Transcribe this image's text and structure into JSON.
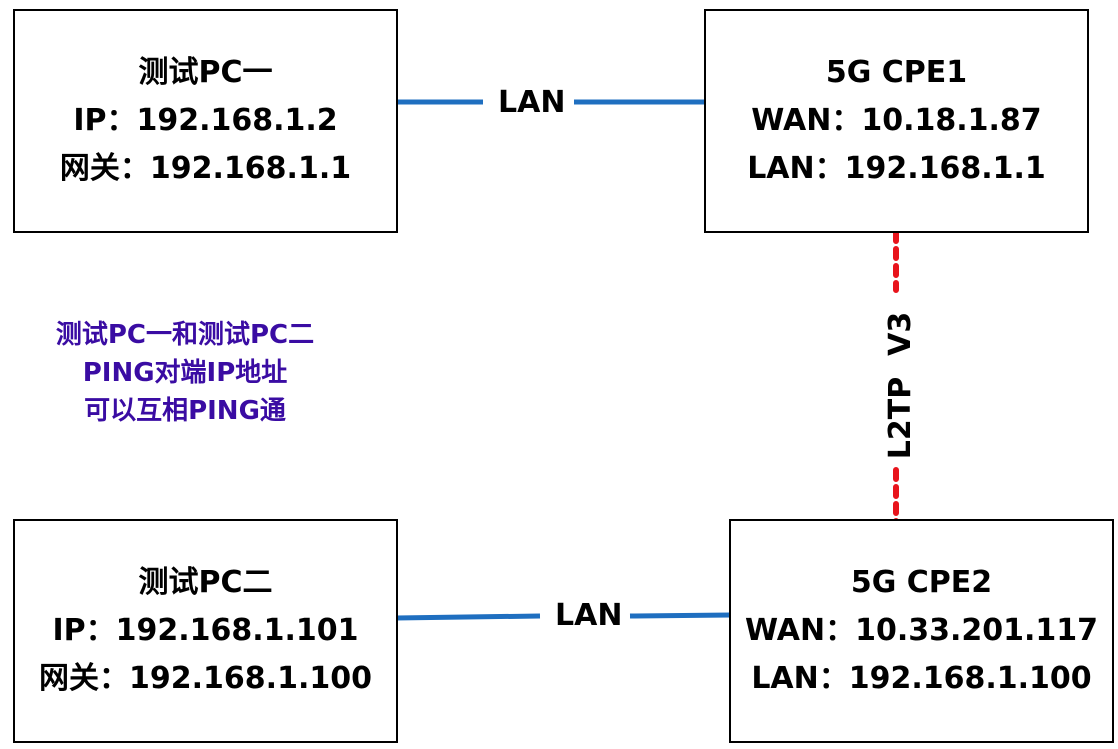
{
  "pc1": {
    "title": "测试PC一",
    "ip": "IP：192.168.1.2",
    "gateway": "网关：192.168.1.1"
  },
  "cpe1": {
    "title": "5G CPE1",
    "wan": "WAN：10.18.1.87",
    "lan": "LAN：192.168.1.1"
  },
  "pc2": {
    "title": "测试PC二",
    "ip": "IP：192.168.1.101",
    "gateway": "网关：192.168.1.100"
  },
  "cpe2": {
    "title": "5G CPE2",
    "wan": "WAN：10.33.201.117",
    "lan": "LAN：192.168.1.100"
  },
  "links": {
    "top_lan": "LAN",
    "bottom_lan": "LAN",
    "tunnel": "L2TP  V3"
  },
  "note": {
    "line1": "测试PC一和测试PC二",
    "line2": "PING对端IP地址",
    "line3": "可以互相PING通"
  },
  "colors": {
    "link": "#1f6fc0",
    "tunnel": "#e8141c",
    "note": "#3a0ca3"
  }
}
